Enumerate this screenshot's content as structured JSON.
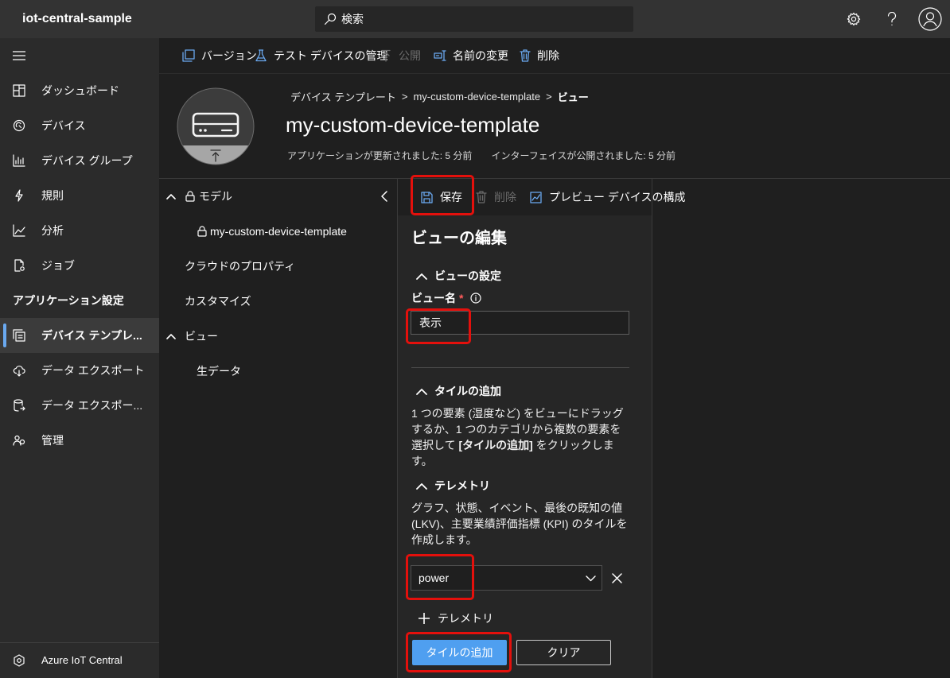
{
  "app": {
    "title": "iot-central-sample"
  },
  "search": {
    "placeholder": "検索",
    "icon": "search-icon"
  },
  "topbar": {
    "icons": [
      "gear-icon",
      "help-icon",
      "avatar-icon"
    ]
  },
  "sidebar": {
    "menu_icon": "hamburger-icon",
    "items": [
      {
        "label": "ダッシュボード",
        "icon": "dashboard-icon"
      },
      {
        "label": "デバイス",
        "icon": "devices-icon"
      },
      {
        "label": "デバイス グループ",
        "icon": "device-groups-icon"
      },
      {
        "label": "規則",
        "icon": "rules-icon"
      },
      {
        "label": "分析",
        "icon": "analytics-icon"
      },
      {
        "label": "ジョブ",
        "icon": "jobs-icon"
      }
    ],
    "section_header": "アプリケーション設定",
    "settings_items": [
      {
        "label": "デバイス テンプレ...",
        "icon": "device-templates-icon",
        "selected": true
      },
      {
        "label": "データ エクスポート",
        "icon": "data-export-icon"
      },
      {
        "label": "データ エクスポー...",
        "icon": "data-export-legacy-icon"
      },
      {
        "label": "管理",
        "icon": "administration-icon"
      }
    ],
    "footer": {
      "label": "Azure IoT Central",
      "icon": "iot-central-logo-icon"
    }
  },
  "commands": [
    {
      "label": "バージョン",
      "icon": "versions-icon",
      "disabled": false
    },
    {
      "label": "テスト デバイスの管理",
      "icon": "flask-icon",
      "disabled": false
    },
    {
      "label": "公開",
      "icon": "publish-icon",
      "disabled": true
    },
    {
      "label": "名前の変更",
      "icon": "rename-icon",
      "disabled": false
    },
    {
      "label": "削除",
      "icon": "trash-icon",
      "disabled": false
    }
  ],
  "template": {
    "image_icon": "device-icon",
    "breadcrumb": [
      "デバイス テンプレート",
      "my-custom-device-template",
      "ビュー"
    ],
    "breadcrumb_separator": ">",
    "title": "my-custom-device-template",
    "status": [
      "アプリケーションが更新されました: 5 分前",
      "インターフェイスが公開されました: 5 分前"
    ]
  },
  "tree": {
    "model": {
      "label": "モデル",
      "expanded": true,
      "locked": true
    },
    "interface": {
      "label": "my-custom-device-template",
      "locked": true
    },
    "cloud_properties": "クラウドのプロパティ",
    "customize": "カスタマイズ",
    "views": {
      "label": "ビュー",
      "expanded": true
    },
    "raw_data": "生データ"
  },
  "editor": {
    "toolbar": [
      {
        "label": "保存",
        "icon": "save-icon",
        "disabled": false
      },
      {
        "label": "削除",
        "icon": "trash-icon",
        "disabled": true
      },
      {
        "label": "プレビュー デバイスの構成",
        "icon": "preview-icon",
        "disabled": false
      }
    ],
    "heading": "ビューの編集",
    "view_settings": {
      "header": "ビューの設定",
      "name_label": "ビュー名",
      "required_mark": "*",
      "name_value": "表示"
    },
    "add_tile": {
      "header": "タイルの追加",
      "lines": [
        [
          "1 つの要素 (湿度など) をビューにドラッグ"
        ],
        [
          "するか、1 つのカテゴリから複数の要素を"
        ],
        [
          "選択して ",
          "[タイルの追加]",
          " をクリックしま"
        ],
        [
          "す。"
        ]
      ]
    },
    "telemetry": {
      "header": "テレメトリ",
      "lines": [
        "グラフ、状態、イベント、最後の既知の値",
        "(LKV)、主要業績評価指標 (KPI) のタイルを",
        "作成します。"
      ],
      "selected": "power",
      "add_label": "テレメトリ"
    },
    "buttons": {
      "primary": "タイルの追加",
      "secondary": "クリア"
    }
  },
  "colors": {
    "accent": "#6aa9f0",
    "primary_button": "#4f9ff0",
    "highlight_box": "#e4100c",
    "required": "#ff5b5b"
  }
}
